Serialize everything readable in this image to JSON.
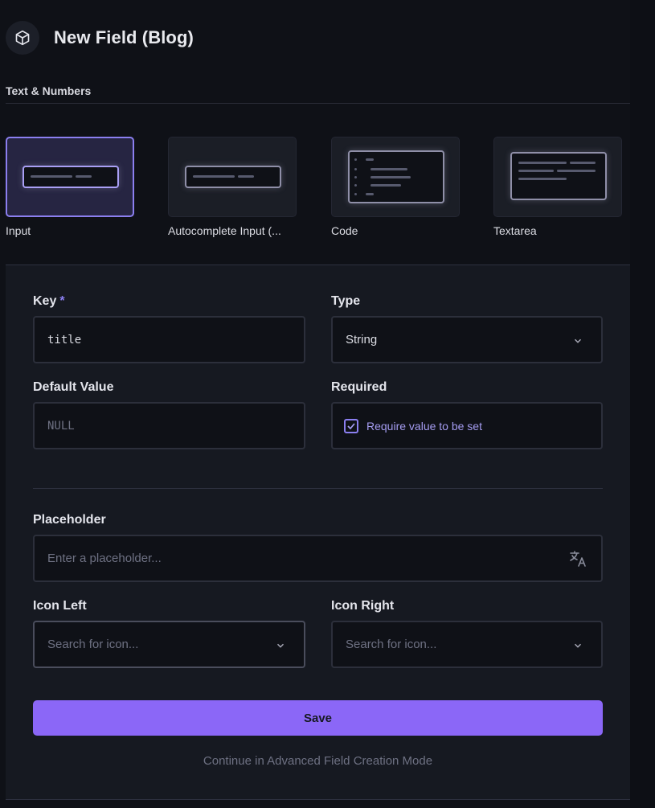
{
  "header": {
    "title": "New Field (Blog)",
    "icon": "box-icon"
  },
  "section": {
    "label": "Text & Numbers"
  },
  "interfaces": [
    {
      "label": "Input",
      "selected": true
    },
    {
      "label": "Autocomplete Input (...",
      "selected": false
    },
    {
      "label": "Code",
      "selected": false
    },
    {
      "label": "Textarea",
      "selected": false
    }
  ],
  "form": {
    "key": {
      "label": "Key",
      "required_marker": "*",
      "value": "title"
    },
    "type": {
      "label": "Type",
      "value": "String"
    },
    "default_value": {
      "label": "Default Value",
      "placeholder": "NULL"
    },
    "required": {
      "label": "Required",
      "checkbox_label": "Require value to be set",
      "checked": true
    },
    "placeholder": {
      "label": "Placeholder",
      "placeholder": "Enter a placeholder..."
    },
    "icon_left": {
      "label": "Icon Left",
      "placeholder": "Search for icon..."
    },
    "icon_right": {
      "label": "Icon Right",
      "placeholder": "Search for icon..."
    },
    "save_label": "Save",
    "advanced_link": "Continue in Advanced Field Creation Mode"
  },
  "colors": {
    "accent": "#8b67f7",
    "accent_light": "#a49cf0",
    "background": "#0f1117",
    "panel": "#161921"
  }
}
